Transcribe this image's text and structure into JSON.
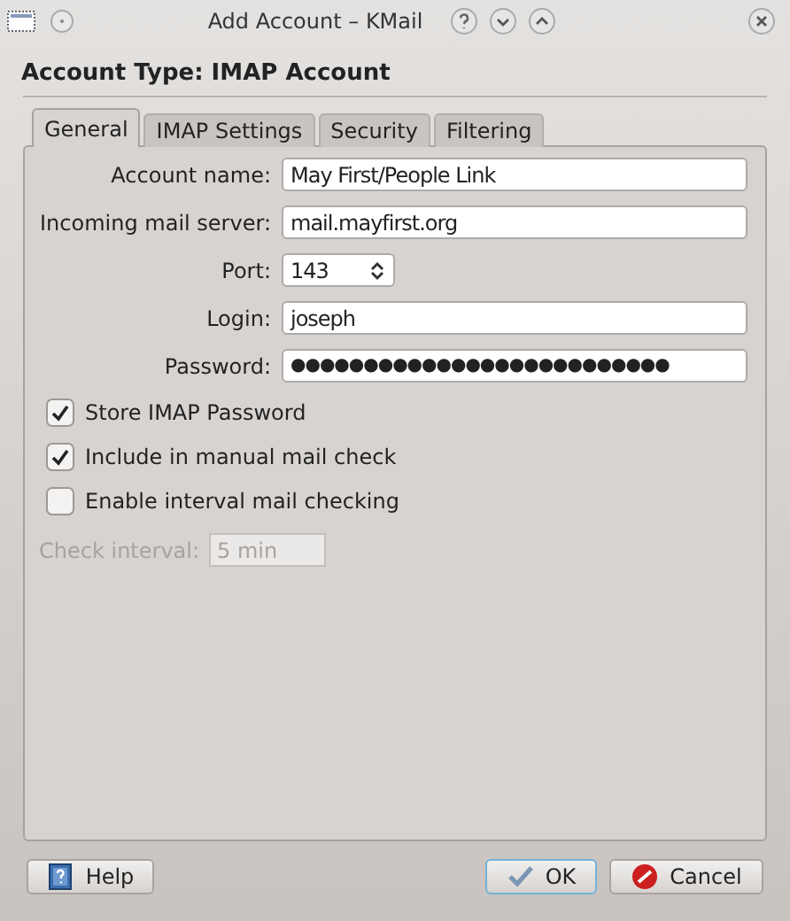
{
  "window": {
    "title": "Add Account – KMail"
  },
  "account_type": "Account Type: IMAP Account",
  "tabs": [
    {
      "label": "General",
      "selected": true
    },
    {
      "label": "IMAP Settings",
      "selected": false
    },
    {
      "label": "Security",
      "selected": false
    },
    {
      "label": "Filtering",
      "selected": false
    }
  ],
  "fields": [
    {
      "kind": "text",
      "label": "Account name:",
      "value": "May First/People Link"
    },
    {
      "kind": "text",
      "label": "Incoming mail server:",
      "value": "mail.mayfirst.org"
    },
    {
      "kind": "spin",
      "label": "Port:",
      "value": "143"
    },
    {
      "kind": "text",
      "label": "Login:",
      "value": "joseph"
    },
    {
      "kind": "text",
      "label": "Password:",
      "value": "●●●●●●●●●●●●●●●●●●●●●●●●●●"
    }
  ],
  "checkboxes": [
    {
      "label": "Store IMAP Password",
      "checked": true
    },
    {
      "label": "Include in manual mail check",
      "checked": true
    },
    {
      "label": "Enable interval mail checking",
      "checked": false
    }
  ],
  "check_interval": {
    "label": "Check interval:",
    "value": "5 min",
    "disabled": true
  },
  "buttons": [
    {
      "kind": "help",
      "label": "Help",
      "default": false
    },
    {
      "kind": "ok",
      "label": "OK",
      "default": true
    },
    {
      "kind": "cancel",
      "label": "Cancel",
      "default": false
    }
  ]
}
